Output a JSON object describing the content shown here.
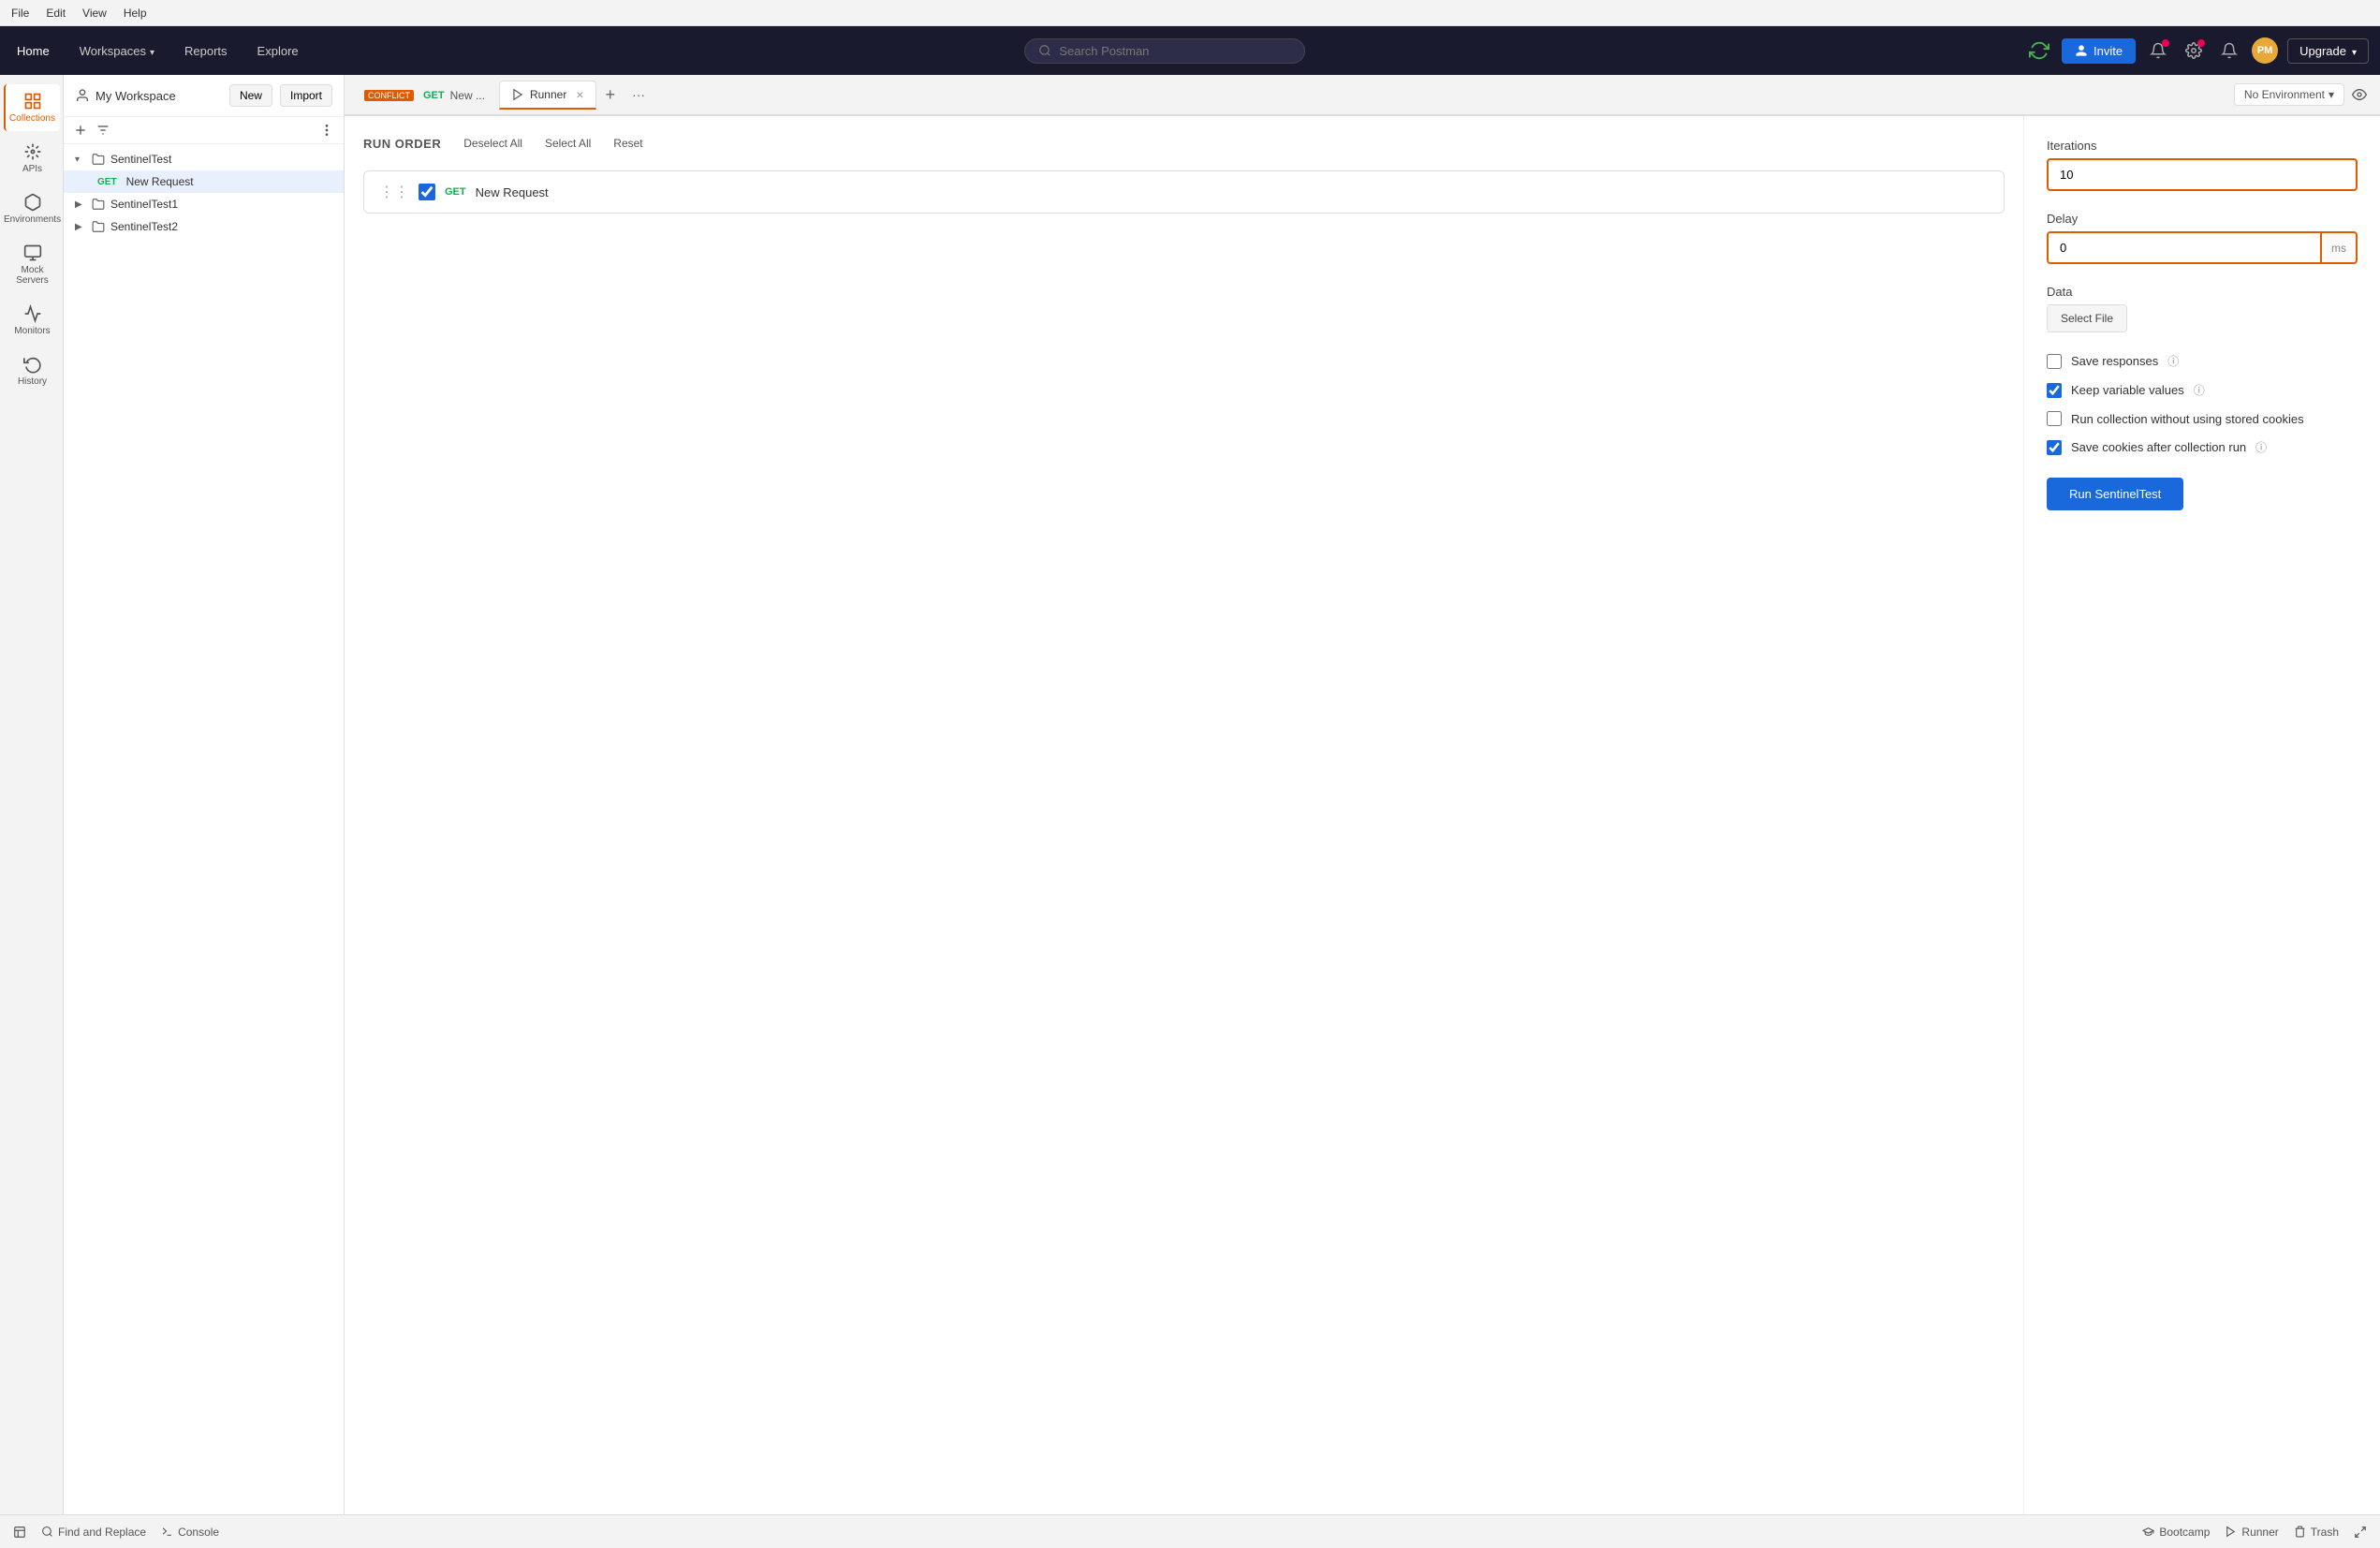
{
  "menubar": {
    "items": [
      "File",
      "Edit",
      "View",
      "Help"
    ]
  },
  "navbar": {
    "home": "Home",
    "workspaces": "Workspaces",
    "reports": "Reports",
    "explore": "Explore",
    "search_placeholder": "Search Postman",
    "invite_label": "Invite",
    "upgrade_label": "Upgrade"
  },
  "sidebar": {
    "workspace_name": "My Workspace",
    "new_button": "New",
    "import_button": "Import",
    "items": [
      {
        "id": "collections",
        "label": "Collections",
        "active": true
      },
      {
        "id": "apis",
        "label": "APIs",
        "active": false
      },
      {
        "id": "environments",
        "label": "Environments",
        "active": false
      },
      {
        "id": "mock-servers",
        "label": "Mock Servers",
        "active": false
      },
      {
        "id": "monitors",
        "label": "Monitors",
        "active": false
      },
      {
        "id": "history",
        "label": "History",
        "active": false
      }
    ]
  },
  "collections": {
    "sentinel_test": {
      "name": "SentinelTest",
      "expanded": true,
      "requests": [
        {
          "method": "GET",
          "name": "New Request",
          "selected": true
        }
      ],
      "sub_collections": [
        {
          "name": "SentinelTest1"
        },
        {
          "name": "SentinelTest2"
        }
      ]
    }
  },
  "tabs": [
    {
      "id": "conflict",
      "conflict": true,
      "conflict_label": "CONFLICT",
      "method": "GET",
      "name": "New ...",
      "active": false
    },
    {
      "id": "runner",
      "icon": "runner",
      "name": "Runner",
      "active": true,
      "closable": true
    }
  ],
  "tab_actions": {
    "add_label": "+",
    "more_label": "···"
  },
  "environment": {
    "current": "No Environment"
  },
  "runner": {
    "title": "RUN ORDER",
    "deselect_all": "Deselect All",
    "select_all": "Select All",
    "reset": "Reset",
    "requests": [
      {
        "method": "GET",
        "name": "New Request",
        "checked": true
      }
    ]
  },
  "settings": {
    "iterations_label": "Iterations",
    "iterations_value": "10",
    "delay_label": "Delay",
    "delay_value": "0",
    "delay_suffix": "ms",
    "data_label": "Data",
    "select_file_label": "Select File",
    "checkboxes": [
      {
        "id": "save-responses",
        "label": "Save responses",
        "checked": false,
        "has_info": true
      },
      {
        "id": "keep-variable-values",
        "label": "Keep variable values",
        "checked": true,
        "has_info": true
      },
      {
        "id": "run-without-cookies",
        "label": "Run collection without using stored cookies",
        "checked": false,
        "has_info": false
      },
      {
        "id": "save-cookies",
        "label": "Save cookies after collection run",
        "checked": true,
        "has_info": true
      }
    ],
    "run_button": "Run SentinelTest"
  },
  "bottombar": {
    "find_replace": "Find and Replace",
    "console": "Console",
    "bootcamp": "Bootcamp",
    "runner": "Runner",
    "trash": "Trash"
  }
}
